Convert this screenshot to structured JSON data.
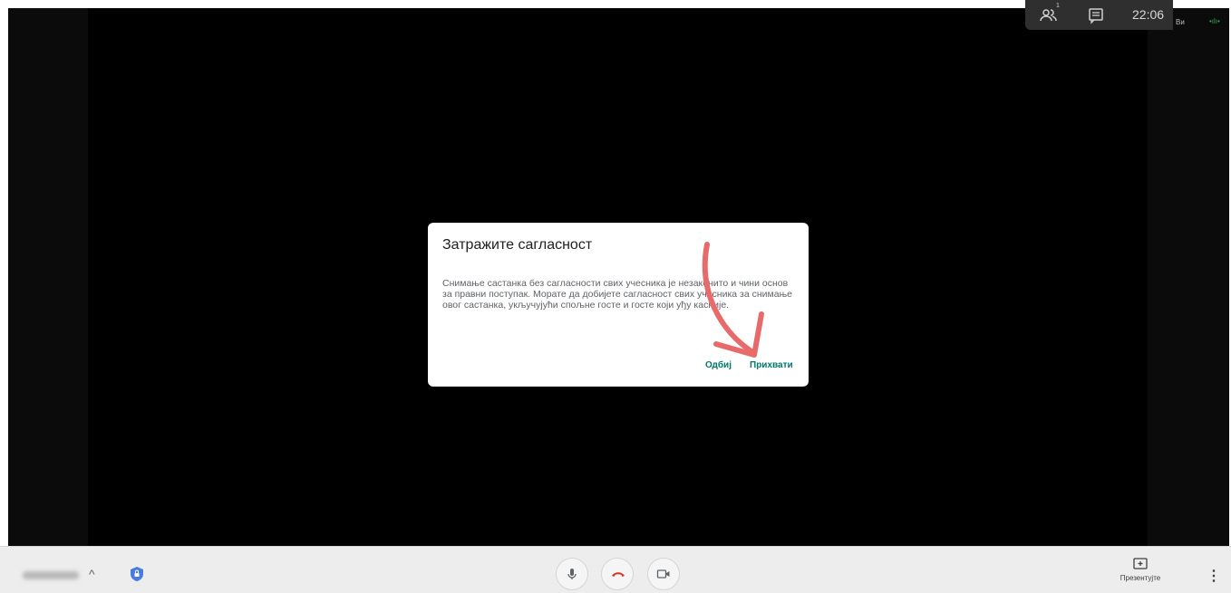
{
  "topbar": {
    "participants_count": "1",
    "clock": "22:06"
  },
  "self_tile": {
    "label": "Ви",
    "mic_indicator": "•ılı•"
  },
  "dialog": {
    "title": "Затражите сагласност",
    "body": "Снимање састанка без сагласности свих учесника је незаконито и чини основ за правни поступак. Морате да добијете сагласност свих учесника за снимање овог састанка, укључујући спољне госте и госте који уђу касније.",
    "reject_label": "Одбиј",
    "accept_label": "Прихвати"
  },
  "bottombar": {
    "present_label": "Презентујте",
    "more_glyph": "⋮",
    "chevron_glyph": "^"
  },
  "colors": {
    "accent": "#00796b",
    "hangup": "#d93025",
    "arrow": "#e86b6b"
  }
}
